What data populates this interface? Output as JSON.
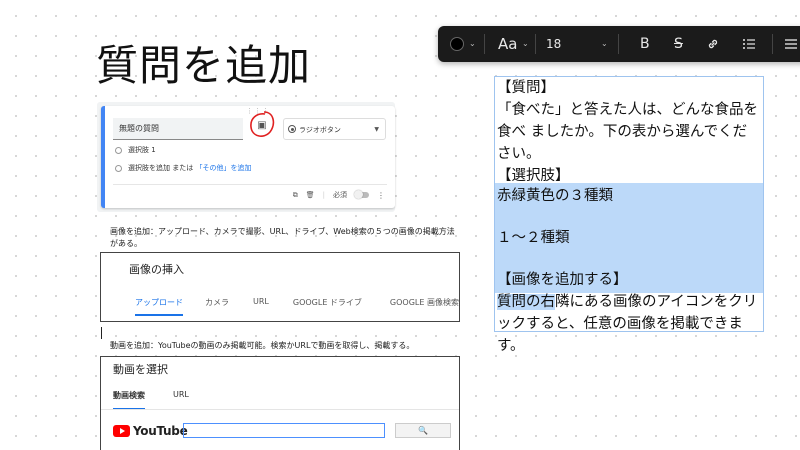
{
  "page": {
    "title": "質問を追加"
  },
  "toolbar": {
    "text_color": "#000000",
    "font_label": "Aa",
    "font_size": "18",
    "bold_label": "B",
    "strike_label": "S",
    "icons": [
      "color-swatch",
      "font-picker",
      "chevron-down",
      "bold",
      "strikethrough",
      "link",
      "bullet-list",
      "align-menu"
    ]
  },
  "form": {
    "question_placeholder": "無題の質問",
    "type_label": "ラジオボタン",
    "option1": "選択肢 1",
    "add_option": "選択肢を追加",
    "add_option_or": " または ",
    "add_other": "「その他」を追加",
    "required_label": "必須",
    "accent_color": "#4285f4",
    "annotation_color": "#e02020"
  },
  "captions": {
    "image": "画像を追加：アップロード、カメラで撮影、URL、ドライブ、Web検索の５つの画像の掲載方法がある。",
    "video": "動画を追加：YouTubeの動画のみ掲載可能。検索かURLで動画を取得し、掲載する。"
  },
  "insert_dialog": {
    "title": "画像の挿入",
    "tabs": [
      "アップロード",
      "カメラ",
      "URL",
      "GOOGLE ドライブ",
      "GOOGLE 画像検索"
    ],
    "active_tab": "アップロード"
  },
  "video_dialog": {
    "title": "動画を選択",
    "tabs": [
      "動画検索",
      "URL"
    ],
    "active_tab": "動画検索",
    "logo_text": "YouTube"
  },
  "textbox": {
    "line1": "【質問】",
    "line2": "「食べた」と答えた人は、どんな食品を食べ ましたか。下の表から選んでください。",
    "line3": "【選択肢】",
    "line4a": "赤緑黄",
    "line4b": "色の３種類",
    "line5": "１〜２種類",
    "line6": "【画像を追加する】",
    "line7a": "質問の右",
    "line7b": "隣にある画像のアイコンをクリックすると、任意の画像を掲載できます。",
    "highlight_color": "#bcd9f9"
  }
}
